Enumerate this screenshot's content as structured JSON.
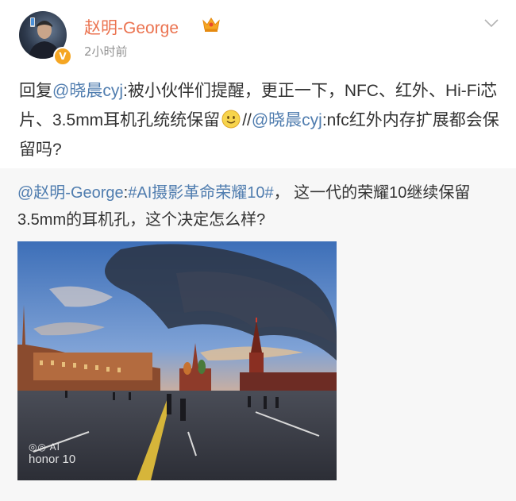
{
  "post": {
    "author": "赵明-George",
    "time": "2小时前",
    "segments": [
      {
        "text": "回复",
        "link": false
      },
      {
        "text": "@晓晨cyj",
        "link": true
      },
      {
        "text": ":被小伙伴们提醒，更正一下，NFC、红外、Hi-Fi芯片、3.5mm耳机孔统统保留",
        "link": false
      },
      {
        "text": "",
        "link": false,
        "emoji": "smile-emoji"
      },
      {
        "text": "//",
        "link": false
      },
      {
        "text": "@晓晨cyj",
        "link": true
      },
      {
        "text": ":nfc红外内存扩展都会保留吗?",
        "link": false
      }
    ]
  },
  "repost": {
    "segments": [
      {
        "text": "@赵明-George",
        "link": true
      },
      {
        "text": ":",
        "link": false
      },
      {
        "text": "#AI摄影革命荣耀10#",
        "link": true
      },
      {
        "text": "， 这一代的荣耀10继续保留3.5mm的耳机孔，这个决定怎么样?",
        "link": false
      }
    ],
    "image": {
      "description_icon": "photo-red-square",
      "watermark_line1": "◎◎ AI",
      "watermark_line2": "honor 10"
    }
  },
  "colors": {
    "username": "#eb7350",
    "link": "#507daf",
    "text": "#333333",
    "muted": "#939393",
    "repost_bg": "#f7f7f7",
    "badge": "#f5a623"
  },
  "icons": {
    "verified": "verified-v-badge-icon",
    "crown": "vip-crown-icon",
    "menu": "chevron-down-icon"
  }
}
